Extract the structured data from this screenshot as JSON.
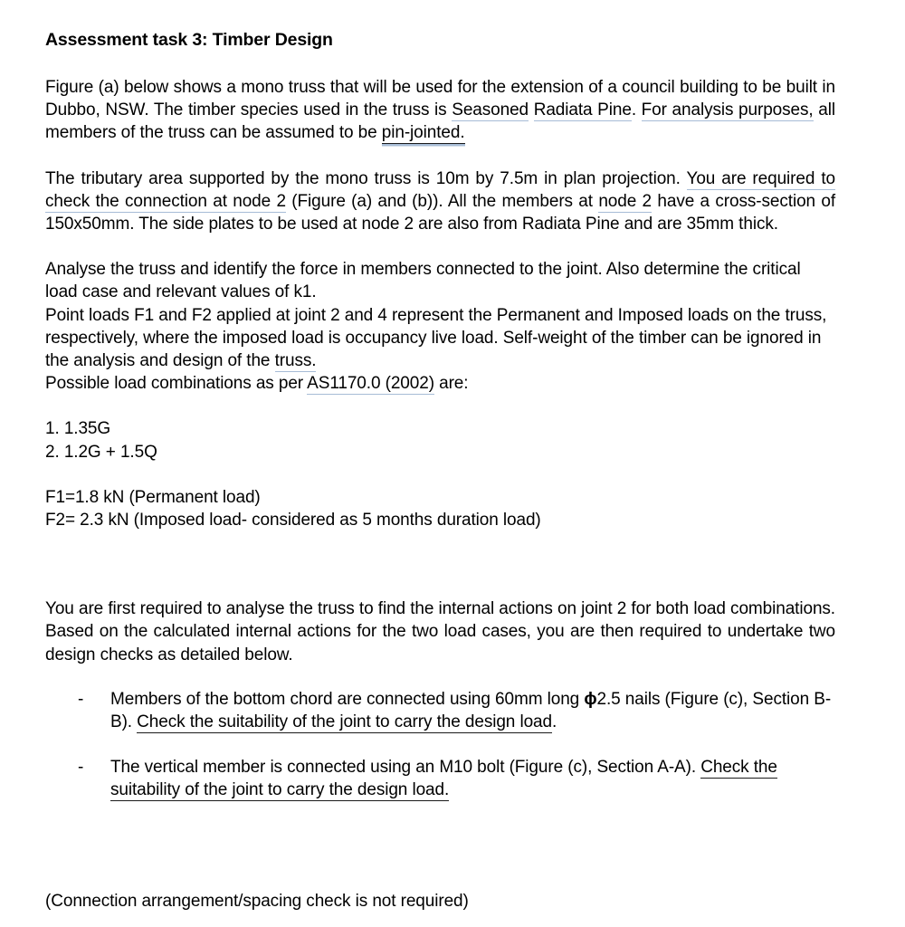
{
  "document": {
    "title": "Assessment task 3: Timber Design",
    "paragraphs": {
      "p1_part1": "Figure (a) below shows a mono truss that will be used for the extension of a council building to be built in Dubbo, NSW. The timber species used in the truss is ",
      "p1_sp1": "Seasoned",
      "p1_part2": " ",
      "p1_sp2": "Radiata Pine",
      "p1_part3": ". ",
      "p1_sp3": "For analysis purposes,",
      "p1_part4": " all members of the truss can be assumed to be ",
      "p1_ul1": "pin-jointed.",
      "p2_part1": "The tributary area supported by the mono truss is 10m by 7.5m in plan projection. ",
      "p2_sp1": "You are required to check the connection at node 2",
      "p2_part2": " (Figure (a) and (b)). All the members at ",
      "p2_sp2": "node 2",
      "p2_part3": " have a cross-section of 150x50mm. The side plates to be used at node 2 are also from Radiata Pine and are 35mm thick.",
      "p3_line1": "Analyse the truss and identify the force in members connected to the joint. Also determine the critical load case and relevant values of k1.",
      "p3_line2a": "Point loads F1 and F2 applied at joint 2 and 4 represent the Permanent and Imposed loads on the truss, respectively, where the imposed load is occupancy live load. Self-weight of the timber can be ignored in the analysis and design of the ",
      "p3_sp1": "truss.",
      "p3_line3a": "Possible load combinations as per ",
      "p3_sp2": "AS1170.0 (2002)",
      "p3_line3b": " are:",
      "p5": "You are first required to analyse the truss to find the internal actions on joint 2 for both load combinations. Based on the calculated internal actions for the two load cases, you are then required to undertake two design checks as detailed below."
    },
    "load_combinations": [
      "1. 1.35G",
      "2. 1.2G + 1.5Q"
    ],
    "load_values": [
      "F1=1.8 kN (Permanent load)",
      "F2= 2.3 kN (Imposed load- considered as 5 months duration load)"
    ],
    "design_checks": {
      "bullet_marker": "-",
      "item1": {
        "text_before_phi": "Members of the bottom chord are connected using 60mm long ",
        "phi": "ϕ",
        "text_after_phi": "2.5 nails (Figure (c), Section B-B). ",
        "underlined": "Check the suitability of the joint to carry the design load",
        "tail": "."
      },
      "item2": {
        "text_before": "The vertical member is connected using an M10 bolt (Figure (c), Section A-A). ",
        "underlined": "Check the suitability of the joint to carry the design load.",
        "tail": ""
      }
    },
    "footnote": "(Connection arrangement/spacing check is not required)",
    "colors": {
      "text": "#000000",
      "background": "#ffffff",
      "spellcheck_underline": "#a7bcd6",
      "manual_underline": "#1a1a1a"
    }
  }
}
